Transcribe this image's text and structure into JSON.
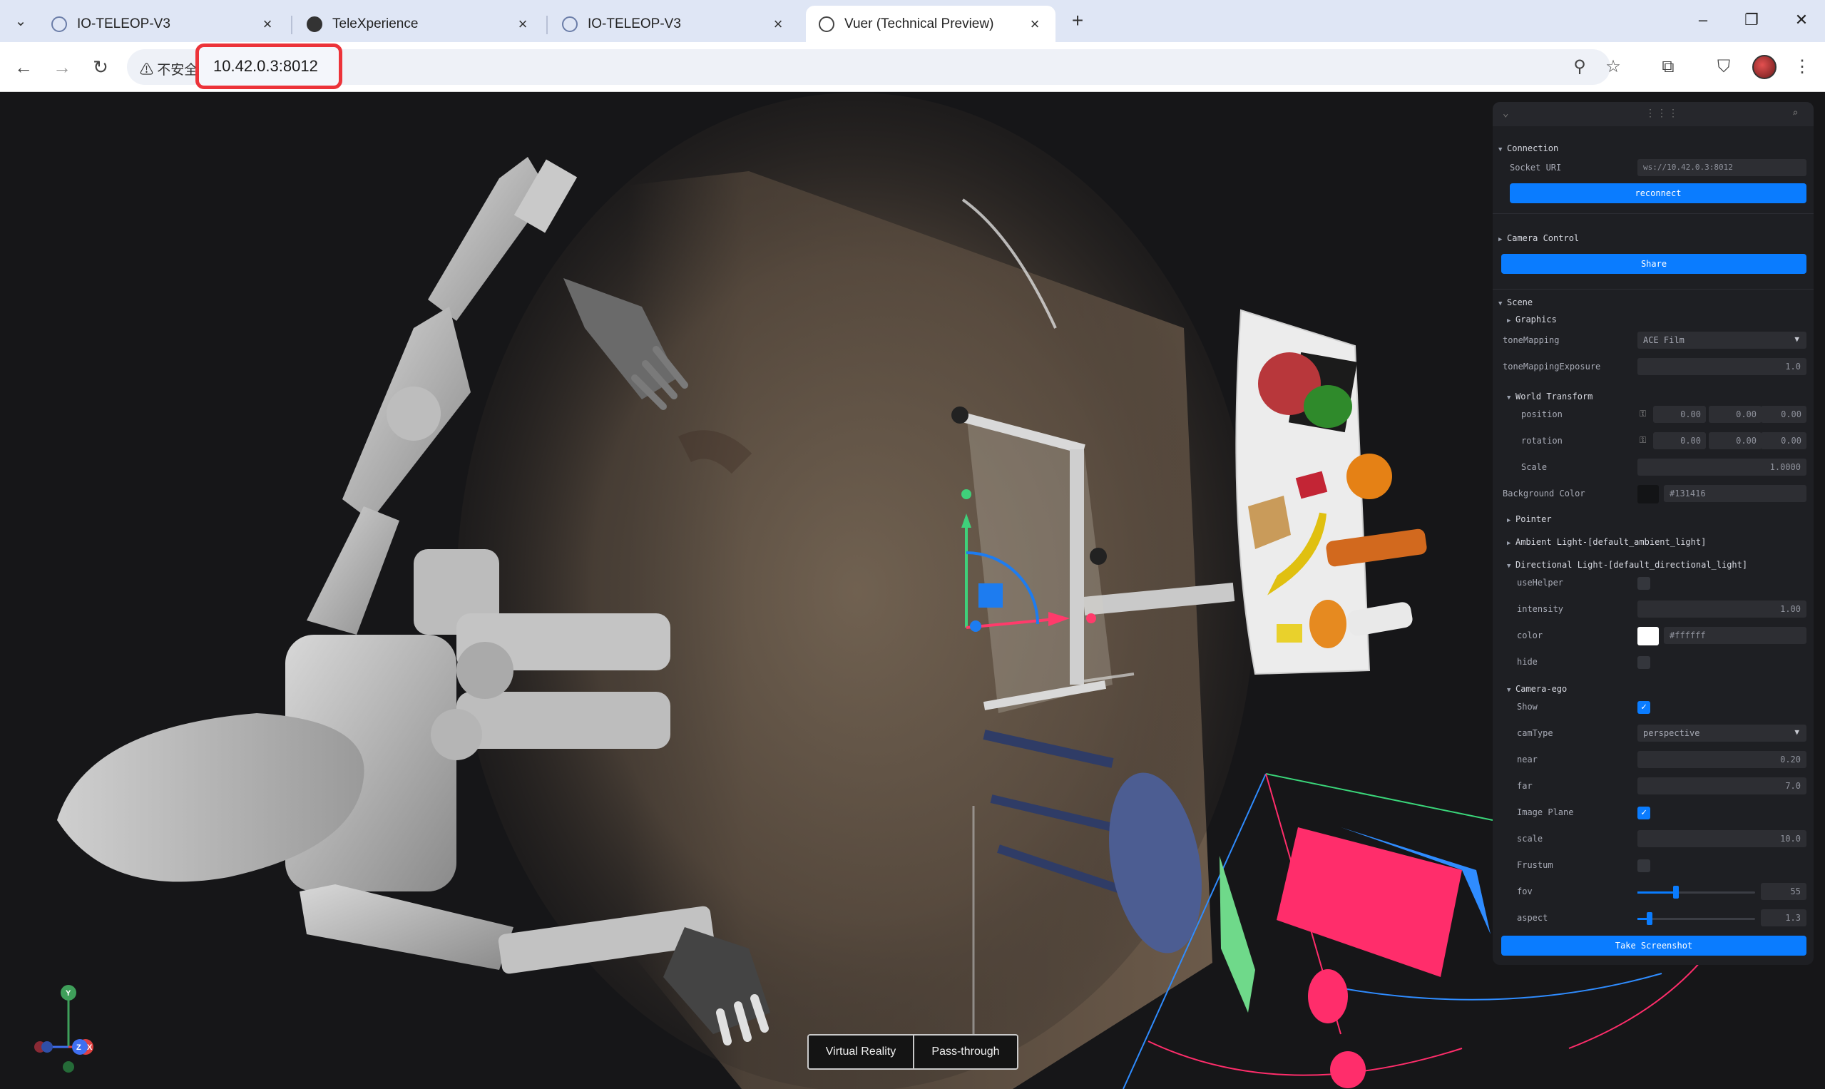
{
  "browser": {
    "tabs": [
      {
        "title": "IO-TELEOP-V3"
      },
      {
        "title": "TeleXperience"
      },
      {
        "title": "IO-TELEOP-V3"
      },
      {
        "title": "Vuer (Technical Preview)"
      }
    ],
    "insecure_label": "不安全",
    "url": "10.42.0.3:8012"
  },
  "viewport": {
    "axis_labels": {
      "y": "Y",
      "z": "Z",
      "x": "X"
    },
    "modes": [
      "Virtual Reality",
      "Pass-through"
    ]
  },
  "panel": {
    "connection": {
      "title": "Connection",
      "socket_label": "Socket URI",
      "socket_value": "ws://10.42.0.3:8012",
      "reconnect": "reconnect"
    },
    "camera_control": {
      "title": "Camera Control",
      "share": "Share"
    },
    "scene": {
      "title": "Scene",
      "graphics": "Graphics",
      "tone_mapping_label": "toneMapping",
      "tone_mapping_value": "ACE Film",
      "tone_exposure_label": "toneMappingExposure",
      "tone_exposure_value": "1.0",
      "world_transform": "World Transform",
      "position_label": "position",
      "position": [
        "0.00",
        "0.00",
        "0.00"
      ],
      "rotation_label": "rotation",
      "rotation": [
        "0.00",
        "0.00",
        "0.00"
      ],
      "scale_label": "Scale",
      "scale_value": "1.0000",
      "bg_color_label": "Background Color",
      "bg_color_value": "#131416",
      "pointer": "Pointer",
      "ambient": "Ambient Light-[default_ambient_light]",
      "directional": "Directional Light-[default_directional_light]",
      "use_helper_label": "useHelper",
      "intensity_label": "intensity",
      "intensity_value": "1.00",
      "color_label": "color",
      "color_value": "#ffffff",
      "hide_label": "hide",
      "camera_ego": "Camera-ego",
      "show_label": "Show",
      "camtype_label": "camType",
      "camtype_value": "perspective",
      "near_label": "near",
      "near_value": "0.20",
      "far_label": "far",
      "far_value": "7.0",
      "image_plane_label": "Image Plane",
      "scale2_label": "scale",
      "scale2_value": "10.0",
      "frustum_label": "Frustum",
      "fov_label": "fov",
      "fov_value": "55",
      "aspect_label": "aspect",
      "aspect_value": "1.3"
    },
    "screenshot": "Take Screenshot"
  },
  "colors": {
    "accent": "#0a7cff",
    "url_highlight": "#ec3339",
    "panel_bg": "#1e1f23",
    "viewport_bg": "#161618"
  },
  "state": {
    "use_helper": false,
    "hide": false,
    "show": true,
    "image_plane": true,
    "frustum": false,
    "fov_fraction": 0.33,
    "aspect_fraction": 0.1
  }
}
